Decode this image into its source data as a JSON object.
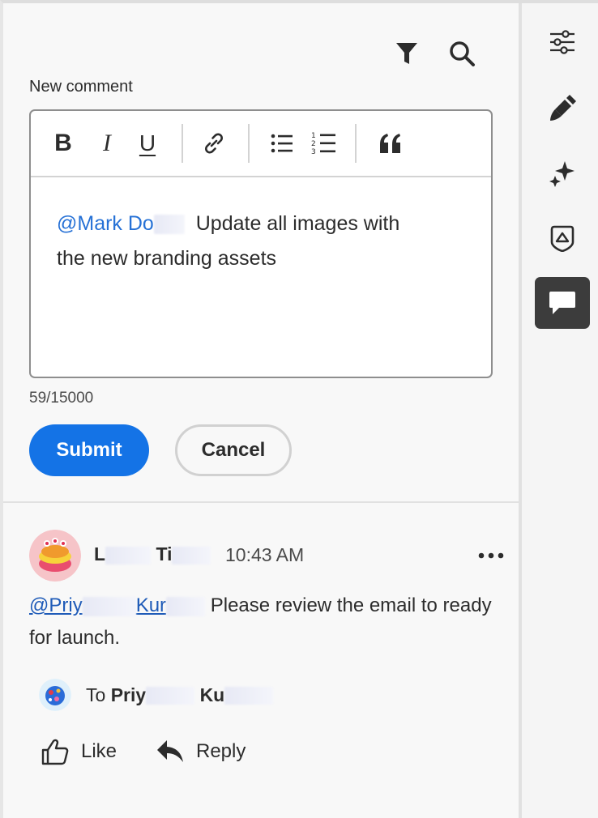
{
  "header": {
    "filter_icon": "filter-icon",
    "search_icon": "search-icon"
  },
  "composer": {
    "label": "New comment",
    "toolbar": {
      "bold": "B",
      "italic": "I",
      "underline": "U",
      "link_icon": "link-icon",
      "bullet_list_icon": "bullet-list-icon",
      "numbered_list_icon": "numbered-list-icon",
      "quote_icon": "quote-icon"
    },
    "mention": "@Mark Do",
    "text_line1": "Update all images with",
    "text_line2": "the new branding assets",
    "char_count": "59/15000",
    "submit_label": "Submit",
    "cancel_label": "Cancel"
  },
  "comment": {
    "author_first": "L",
    "author_last": "Ti",
    "timestamp": "10:43 AM",
    "more_icon": "more-icon",
    "mention_start": "@Priy",
    "mention_mid": "Kur",
    "body_rest": "Please review the email to ready",
    "body_line2": "for launch.",
    "to_prefix": "To",
    "to_name_first": "Priy",
    "to_name_last": "Ku",
    "like_label": "Like",
    "reply_label": "Reply"
  },
  "rail": {
    "items": [
      "properties-icon",
      "brush-icon",
      "sparkle-icon",
      "asset-icon",
      "comments-icon"
    ],
    "active": "comments-icon"
  },
  "colors": {
    "accent": "#1473e6",
    "mention": "#2671d6",
    "rail_active": "#3c3c3c"
  }
}
